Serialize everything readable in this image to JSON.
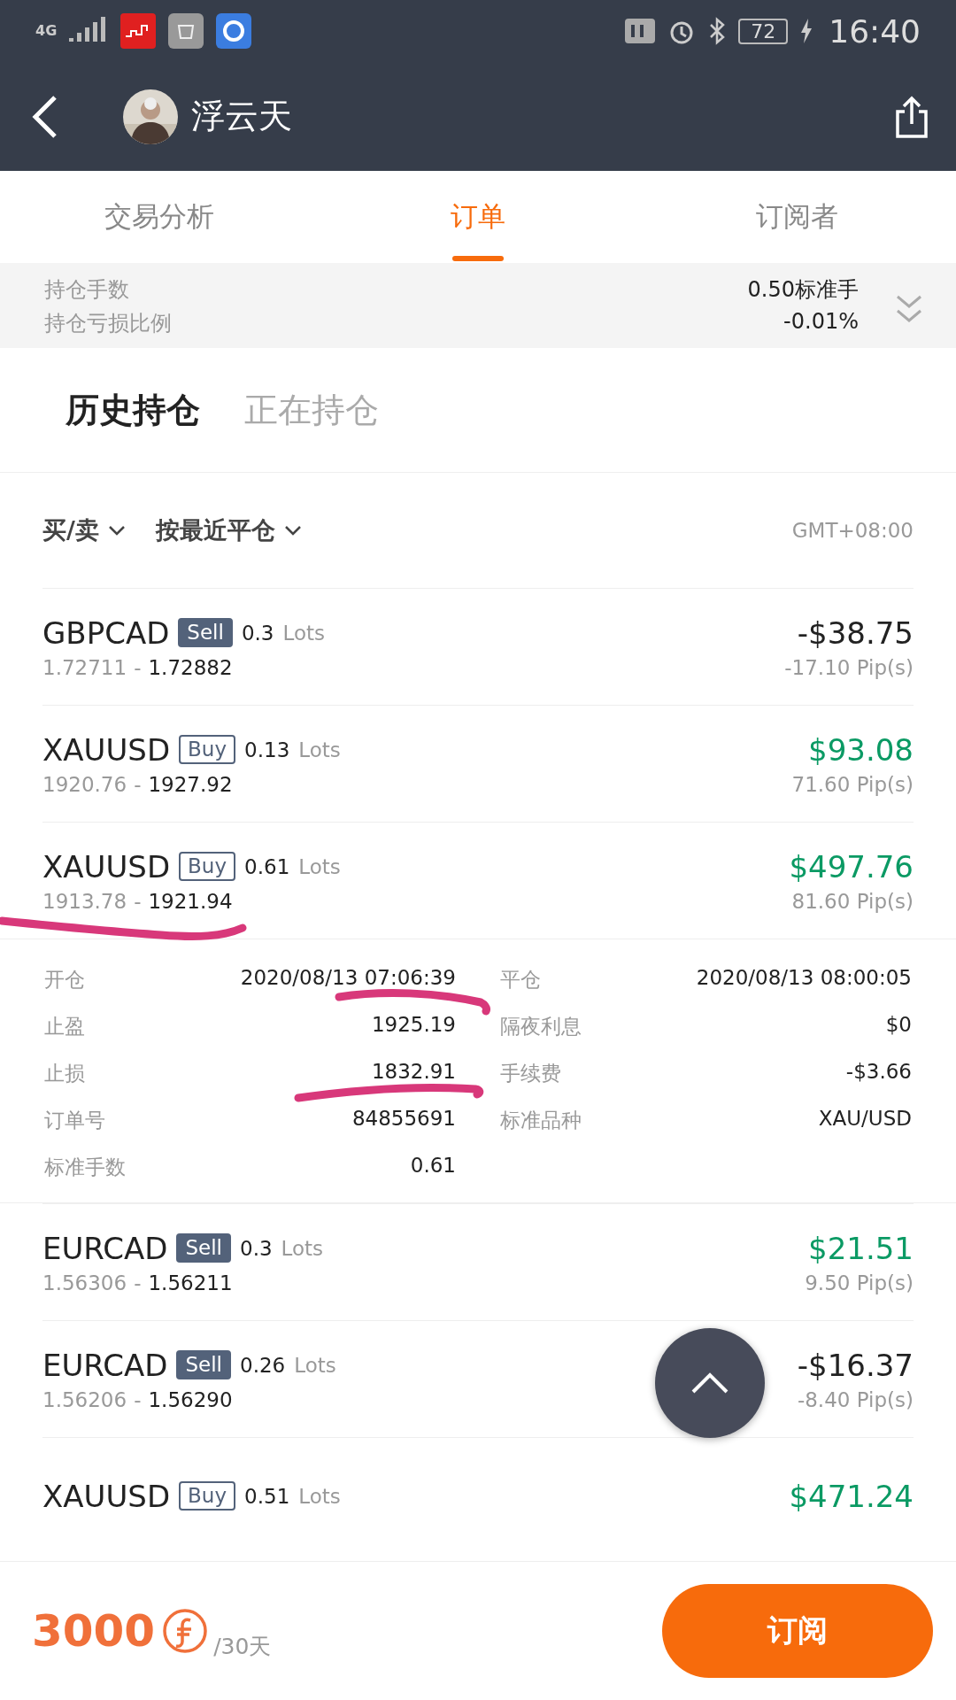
{
  "status_bar": {
    "network": "4G",
    "battery": "72",
    "time": "16:40"
  },
  "header": {
    "title": "浮云天"
  },
  "tabs": [
    {
      "label": "交易分析",
      "selected": false
    },
    {
      "label": "订单",
      "selected": true
    },
    {
      "label": "订阅者",
      "selected": false
    }
  ],
  "summary": [
    {
      "label": "持仓手数",
      "value": "0.50标准手"
    },
    {
      "label": "持仓亏损比例",
      "value": "-0.01%"
    }
  ],
  "section_tabs": [
    {
      "label": "历史持仓",
      "selected": true
    },
    {
      "label": "正在持仓",
      "selected": false
    }
  ],
  "filters": [
    {
      "label": "买/卖"
    },
    {
      "label": "按最近平仓"
    }
  ],
  "timezone": "GMT+08:00",
  "trades": [
    {
      "symbol": "GBPCAD",
      "kind": "sell",
      "side": "Sell",
      "lots": "0.3",
      "lots_unit": "Lots",
      "open": "1.72711",
      "separator": "-",
      "close": "1.72882",
      "profit": "-$38.75",
      "gain": false,
      "pips": "-17.10 Pip(s)"
    },
    {
      "symbol": "XAUUSD",
      "kind": "buy",
      "side": "Buy",
      "lots": "0.13",
      "lots_unit": "Lots",
      "open": "1920.76",
      "separator": "-",
      "close": "1927.92",
      "profit": "$93.08",
      "gain": true,
      "pips": "71.60 Pip(s)"
    },
    {
      "symbol": "XAUUSD",
      "kind": "buy",
      "side": "Buy",
      "lots": "0.61",
      "lots_unit": "Lots",
      "open": "1913.78",
      "separator": "-",
      "close": "1921.94",
      "profit": "$497.76",
      "gain": true,
      "pips": "81.60 Pip(s)",
      "details": [
        {
          "label": "开仓",
          "value": "2020/08/13 07:06:39"
        },
        {
          "label": "平仓",
          "value": "2020/08/13 08:00:05"
        },
        {
          "label": "止盈",
          "value": "1925.19"
        },
        {
          "label": "隔夜利息",
          "value": "$0"
        },
        {
          "label": "止损",
          "value": "1832.91"
        },
        {
          "label": "手续费",
          "value": "-$3.66"
        },
        {
          "label": "订单号",
          "value": "84855691"
        },
        {
          "label": "标准品种",
          "value": "XAU/USD"
        },
        {
          "label": "标准手数",
          "value": "0.61"
        }
      ]
    },
    {
      "symbol": "EURCAD",
      "kind": "sell",
      "side": "Sell",
      "lots": "0.3",
      "lots_unit": "Lots",
      "open": "1.56306",
      "separator": "-",
      "close": "1.56211",
      "profit": "$21.51",
      "gain": true,
      "pips": "9.50 Pip(s)"
    },
    {
      "symbol": "EURCAD",
      "kind": "sell",
      "side": "Sell",
      "lots": "0.26",
      "lots_unit": "Lots",
      "open": "1.56206",
      "separator": "-",
      "close": "1.56290",
      "profit": "-$16.37",
      "gain": false,
      "pips": "-8.40 Pip(s)"
    },
    {
      "symbol": "XAUUSD",
      "kind": "buy",
      "side": "Buy",
      "lots": "0.51",
      "lots_unit": "Lots",
      "profit": "$471.24",
      "gain": true
    }
  ],
  "footer": {
    "price": "3000",
    "period": "/30天",
    "button": "订阅"
  }
}
